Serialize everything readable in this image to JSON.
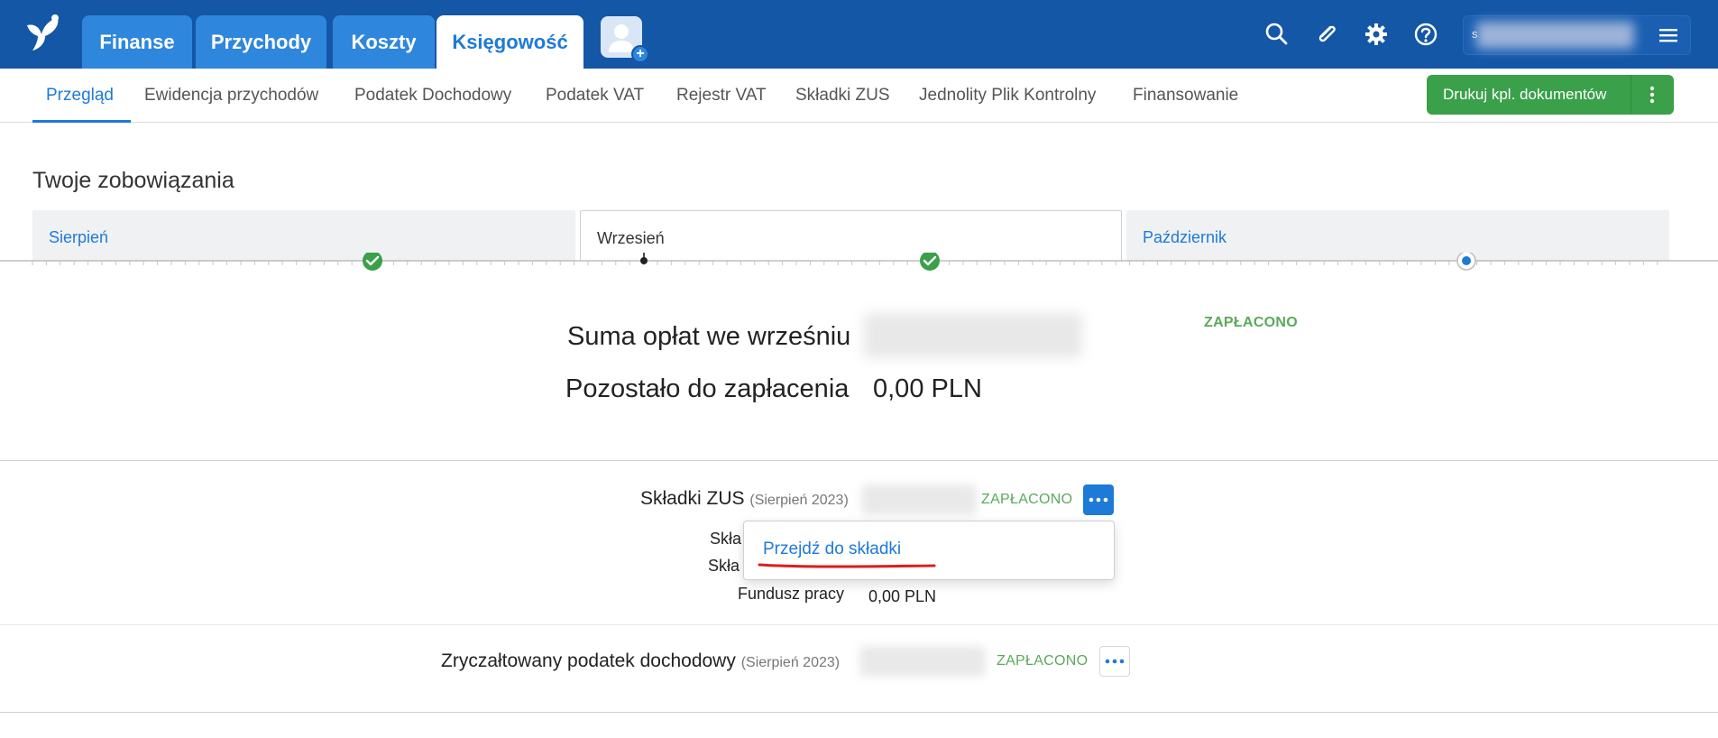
{
  "topbar": {
    "tabs": [
      {
        "label": "Finanse"
      },
      {
        "label": "Przychody"
      },
      {
        "label": "Koszty"
      },
      {
        "label": "Księgowość",
        "active": true
      }
    ],
    "icons": [
      "search-icon",
      "paperclip-icon",
      "gear-icon",
      "help-icon",
      "hamburger-menu-icon"
    ],
    "user_initial": "s",
    "brand_color": "#1457a7"
  },
  "subnav": {
    "items": [
      {
        "label": "Przegląd",
        "active": true
      },
      {
        "label": "Ewidencja przychodów"
      },
      {
        "label": "Podatek Dochodowy"
      },
      {
        "label": "Podatek VAT"
      },
      {
        "label": "Rejestr VAT"
      },
      {
        "label": "Składki ZUS"
      },
      {
        "label": "Jednolity Plik Kontrolny"
      },
      {
        "label": "Finansowanie"
      }
    ],
    "print_button_label": "Drukuj kpl. dokumentów",
    "accent_color": "#3aa04a"
  },
  "obligations": {
    "title": "Twoje zobowiązania",
    "months": [
      {
        "label": "Sierpień",
        "status": "paid"
      },
      {
        "label": "Wrzesień",
        "status": "paid",
        "active": true
      },
      {
        "label": "Październik",
        "status": "current"
      }
    ]
  },
  "summary": {
    "total_label": "Suma opłat we wrześniu",
    "remaining_label": "Pozostało do zapłacenia",
    "remaining_value": "0,00 PLN",
    "status": "ZAPŁACONO"
  },
  "items": [
    {
      "title": "Składki ZUS",
      "period": "(Sierpień 2023)",
      "status": "ZAPŁACONO",
      "rows": [
        {
          "label": "Skła"
        },
        {
          "label": "Skła"
        },
        {
          "label": "Fundusz pracy",
          "value": "0,00 PLN"
        }
      ]
    },
    {
      "title": "Zryczałtowany podatek dochodowy",
      "period": "(Sierpień 2023)",
      "status": "ZAPŁACONO"
    }
  ],
  "dropdown": {
    "link_label": "Przejdź do składki"
  }
}
